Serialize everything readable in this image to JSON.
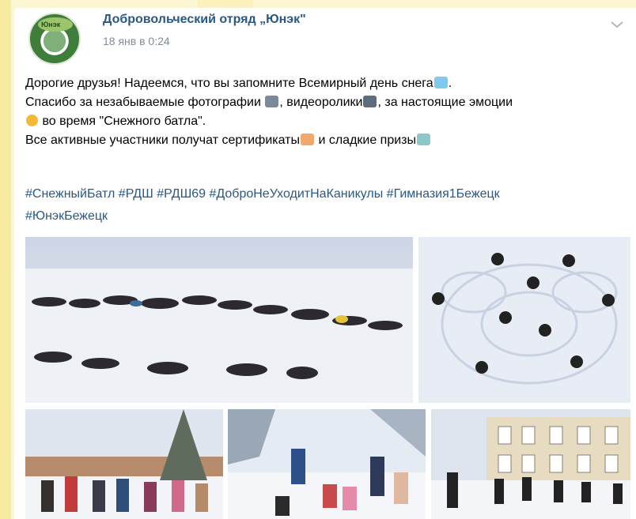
{
  "post": {
    "group_name": "Добровольческий отряд „Юнэк\"",
    "date": "18 янв в 0:24",
    "avatar_label": "Юнэк",
    "text_lines": {
      "line1": "Дорогие друзья! Надеемся, что вы запомните Всемирный день снега",
      "line1_end": ".",
      "line2_a": "Спасибо за незабываемые фотографии ",
      "line2_b": ", видеоролики",
      "line2_c": ", за настоящие эмоции",
      "line3": " во время \"Снежного батла\".",
      "line4_a": "Все активные участники получат сертификаты",
      "line4_b": " и сладкие призы"
    },
    "hashtags": {
      "line1": "#СнежныйБатл #РДШ #РДШ69 #ДоброНеУходитНаКаникулы #Гимназия1Бежецк",
      "line2": "#ЮнэкБежецк"
    },
    "emoji_icons": [
      "snowflake-icon",
      "camera-icon",
      "video-camera-icon",
      "silly-face-icon",
      "clapping-hands-icon",
      "candy-icon"
    ],
    "photos": [
      "photo-snow-line",
      "photo-snow-flower",
      "photo-kids-trees",
      "photo-kids-snow",
      "photo-school-building"
    ]
  },
  "colors": {
    "link": "#2a5885",
    "meta": "#818c99",
    "background": "#fdf6d2"
  }
}
